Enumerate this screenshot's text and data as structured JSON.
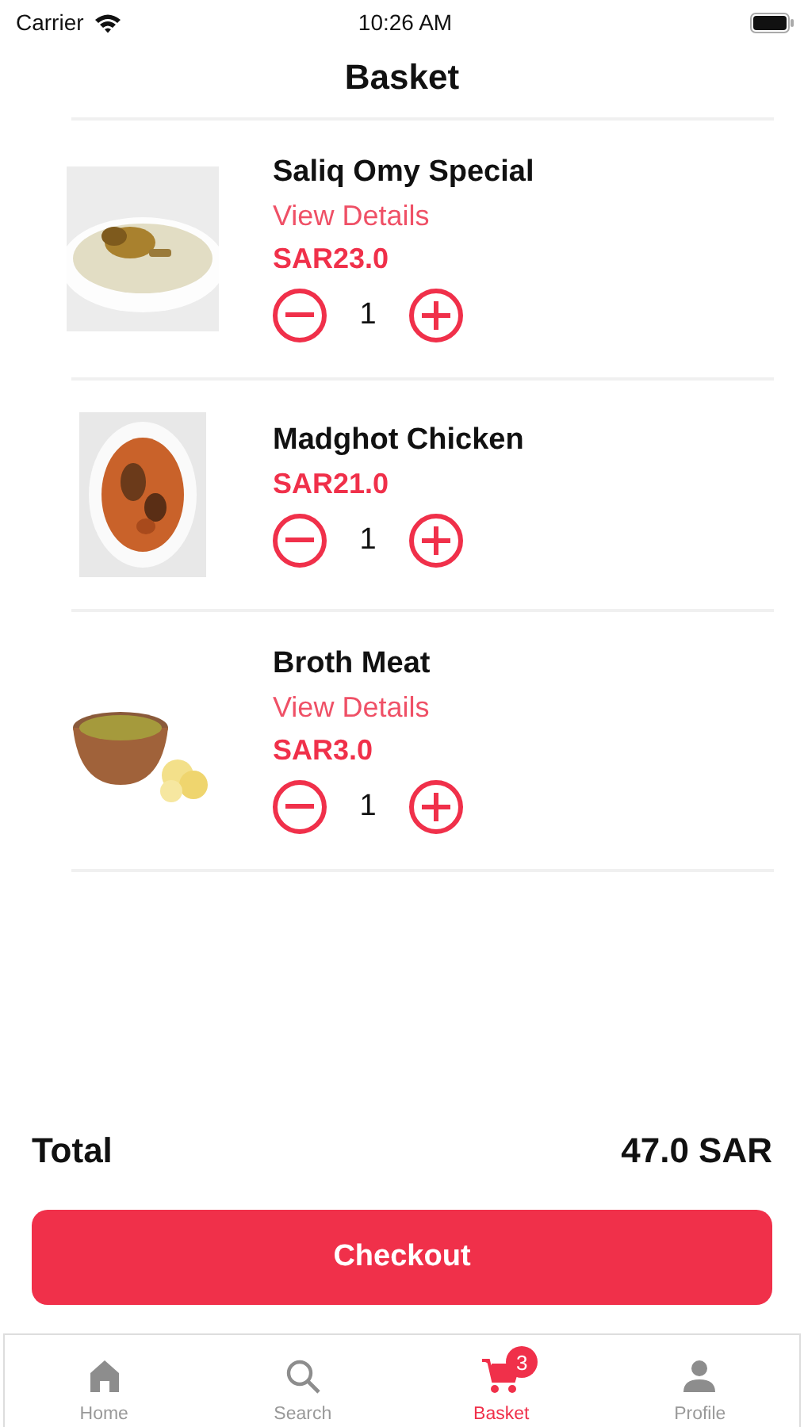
{
  "status_bar": {
    "carrier": "Carrier",
    "time": "10:26 AM"
  },
  "title": "Basket",
  "items": [
    {
      "name": "Saliq Omy Special",
      "details_link": "View Details",
      "price": "SAR23.0",
      "quantity": "1"
    },
    {
      "name": "Madghot Chicken",
      "price": "SAR21.0",
      "quantity": "1"
    },
    {
      "name": "Broth Meat",
      "details_link": "View Details",
      "price": "SAR3.0",
      "quantity": "1"
    }
  ],
  "total": {
    "label": "Total",
    "value": "47.0 SAR"
  },
  "checkout_button": "Checkout",
  "tabs": [
    {
      "label": "Home",
      "selected": false
    },
    {
      "label": "Search",
      "selected": false
    },
    {
      "label": "Basket",
      "selected": true,
      "badge": "3"
    },
    {
      "label": "Profile",
      "selected": false
    }
  ]
}
